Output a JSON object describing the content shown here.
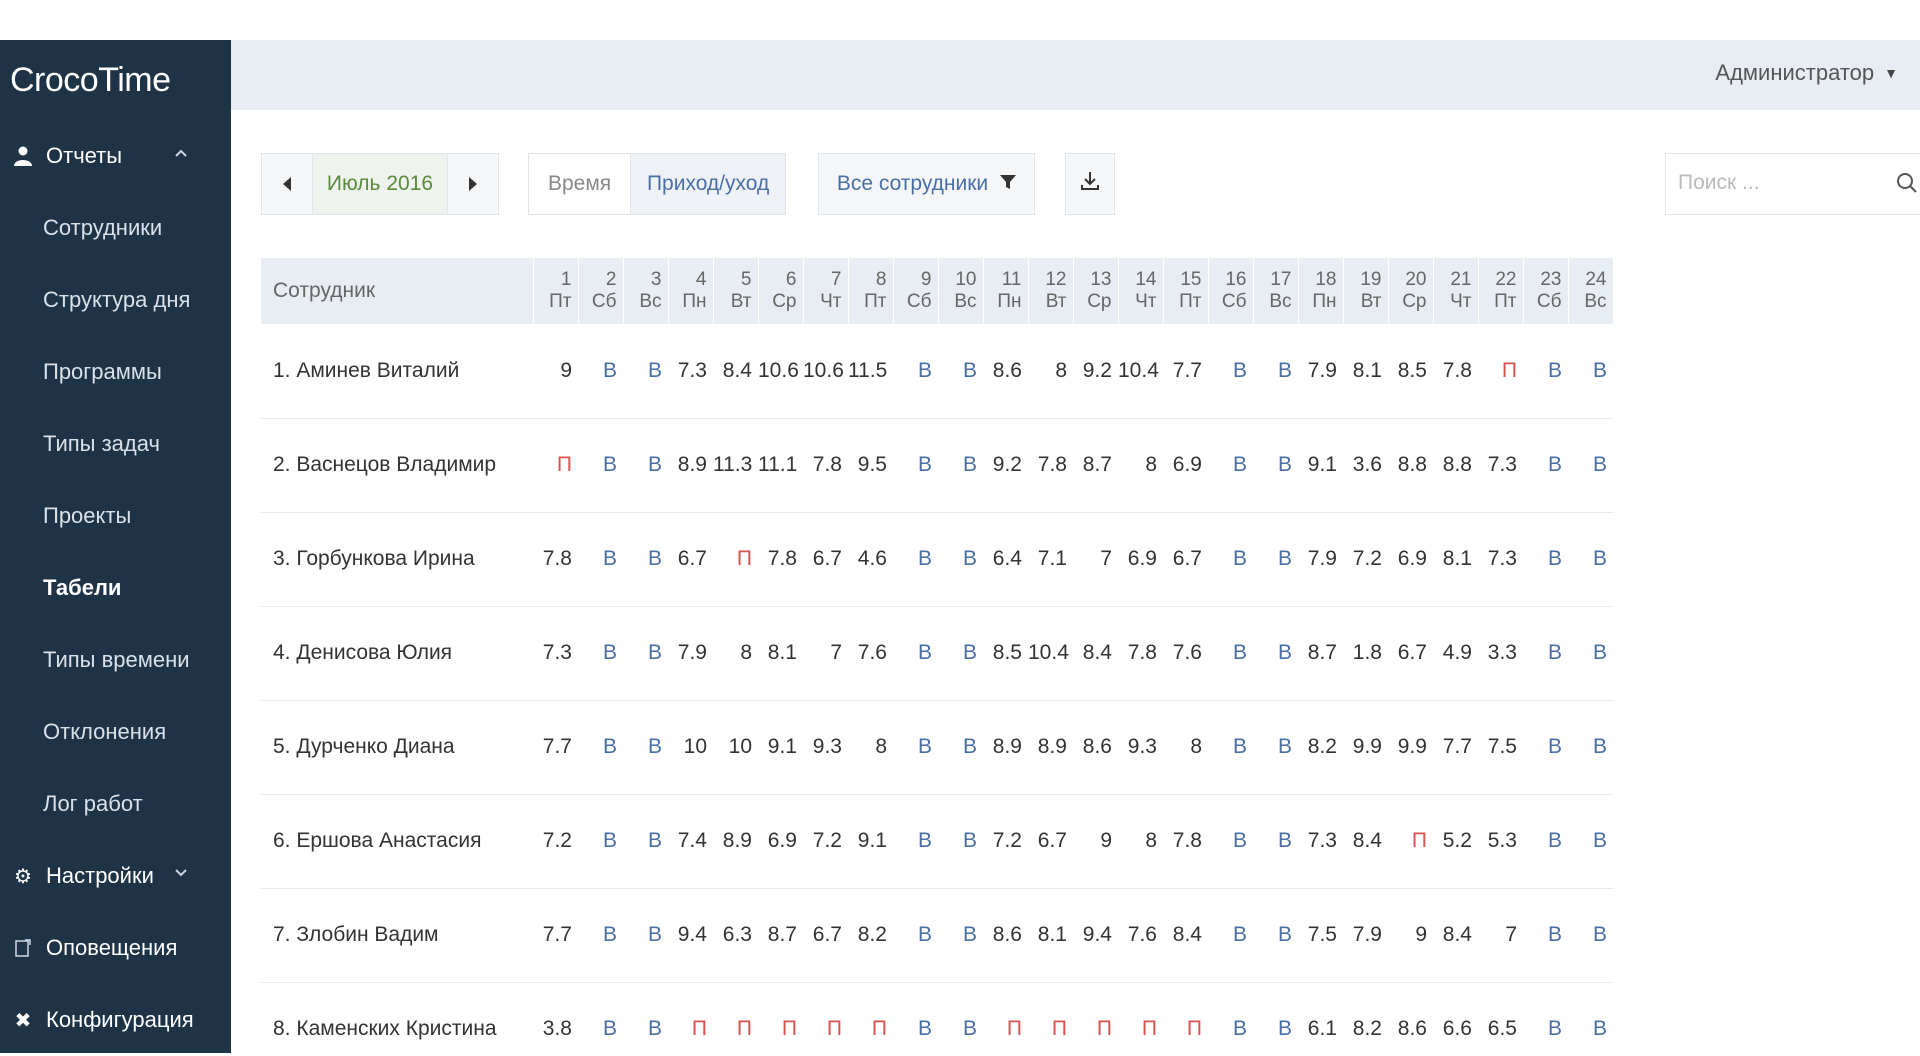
{
  "app": {
    "title": "CrocoTime"
  },
  "header": {
    "user_label": "Администратор"
  },
  "sidebar": {
    "reports_label": "Отчеты",
    "items": [
      {
        "label": "Сотрудники",
        "active": false
      },
      {
        "label": "Структура дня",
        "active": false
      },
      {
        "label": "Программы",
        "active": false
      },
      {
        "label": "Типы задач",
        "active": false
      },
      {
        "label": "Проекты",
        "active": false
      },
      {
        "label": "Табели",
        "active": true
      },
      {
        "label": "Типы времени",
        "active": false
      },
      {
        "label": "Отклонения",
        "active": false
      },
      {
        "label": "Лог работ",
        "active": false
      }
    ],
    "settings_label": "Настройки",
    "notifications_label": "Оповещения",
    "config_label": "Конфигурация"
  },
  "toolbar": {
    "month_label": "Июль 2016",
    "mode_time": "Время",
    "mode_in_out": "Приход/уход",
    "employees_filter": "Все сотрудники",
    "search_placeholder": "Поиск ..."
  },
  "table": {
    "name_header": "Сотрудник",
    "days": [
      {
        "num": "1",
        "dow": "Пт"
      },
      {
        "num": "2",
        "dow": "Сб"
      },
      {
        "num": "3",
        "dow": "Вс"
      },
      {
        "num": "4",
        "dow": "Пн"
      },
      {
        "num": "5",
        "dow": "Вт"
      },
      {
        "num": "6",
        "dow": "Ср"
      },
      {
        "num": "7",
        "dow": "Чт"
      },
      {
        "num": "8",
        "dow": "Пт"
      },
      {
        "num": "9",
        "dow": "Сб"
      },
      {
        "num": "10",
        "dow": "Вс"
      },
      {
        "num": "11",
        "dow": "Пн"
      },
      {
        "num": "12",
        "dow": "Вт"
      },
      {
        "num": "13",
        "dow": "Ср"
      },
      {
        "num": "14",
        "dow": "Чт"
      },
      {
        "num": "15",
        "dow": "Пт"
      },
      {
        "num": "16",
        "dow": "Сб"
      },
      {
        "num": "17",
        "dow": "Вс"
      },
      {
        "num": "18",
        "dow": "Пн"
      },
      {
        "num": "19",
        "dow": "Вт"
      },
      {
        "num": "20",
        "dow": "Ср"
      },
      {
        "num": "21",
        "dow": "Чт"
      },
      {
        "num": "22",
        "dow": "Пт"
      },
      {
        "num": "23",
        "dow": "Сб"
      },
      {
        "num": "24",
        "dow": "Вс"
      }
    ],
    "rows": [
      {
        "name": "1. Аминев Виталий",
        "values": [
          "9",
          "В",
          "В",
          "7.3",
          "8.4",
          "10.6",
          "10.6",
          "11.5",
          "В",
          "В",
          "8.6",
          "8",
          "9.2",
          "10.4",
          "7.7",
          "В",
          "В",
          "7.9",
          "8.1",
          "8.5",
          "7.8",
          "П",
          "В",
          "В"
        ]
      },
      {
        "name": "2. Васнецов Владимир",
        "values": [
          "П",
          "В",
          "В",
          "8.9",
          "11.3",
          "11.1",
          "7.8",
          "9.5",
          "В",
          "В",
          "9.2",
          "7.8",
          "8.7",
          "8",
          "6.9",
          "В",
          "В",
          "9.1",
          "3.6",
          "8.8",
          "8.8",
          "7.3",
          "В",
          "В"
        ]
      },
      {
        "name": "3. Горбункова Ирина",
        "values": [
          "7.8",
          "В",
          "В",
          "6.7",
          "П",
          "7.8",
          "6.7",
          "4.6",
          "В",
          "В",
          "6.4",
          "7.1",
          "7",
          "6.9",
          "6.7",
          "В",
          "В",
          "7.9",
          "7.2",
          "6.9",
          "8.1",
          "7.3",
          "В",
          "В"
        ]
      },
      {
        "name": "4. Денисова Юлия",
        "values": [
          "7.3",
          "В",
          "В",
          "7.9",
          "8",
          "8.1",
          "7",
          "7.6",
          "В",
          "В",
          "8.5",
          "10.4",
          "8.4",
          "7.8",
          "7.6",
          "В",
          "В",
          "8.7",
          "1.8",
          "6.7",
          "4.9",
          "3.3",
          "В",
          "В"
        ]
      },
      {
        "name": "5. Дурченко Диана",
        "values": [
          "7.7",
          "В",
          "В",
          "10",
          "10",
          "9.1",
          "9.3",
          "8",
          "В",
          "В",
          "8.9",
          "8.9",
          "8.6",
          "9.3",
          "8",
          "В",
          "В",
          "8.2",
          "9.9",
          "9.9",
          "7.7",
          "7.5",
          "В",
          "В"
        ]
      },
      {
        "name": "6. Ершова Анастасия",
        "values": [
          "7.2",
          "В",
          "В",
          "7.4",
          "8.9",
          "6.9",
          "7.2",
          "9.1",
          "В",
          "В",
          "7.2",
          "6.7",
          "9",
          "8",
          "7.8",
          "В",
          "В",
          "7.3",
          "8.4",
          "П",
          "5.2",
          "5.3",
          "В",
          "В"
        ]
      },
      {
        "name": "7. Злобин Вадим",
        "values": [
          "7.7",
          "В",
          "В",
          "9.4",
          "6.3",
          "8.7",
          "6.7",
          "8.2",
          "В",
          "В",
          "8.6",
          "8.1",
          "9.4",
          "7.6",
          "8.4",
          "В",
          "В",
          "7.5",
          "7.9",
          "9",
          "8.4",
          "7",
          "В",
          "В"
        ]
      },
      {
        "name": "8. Каменских Кристина",
        "values": [
          "3.8",
          "В",
          "В",
          "П",
          "П",
          "П",
          "П",
          "П",
          "В",
          "В",
          "П",
          "П",
          "П",
          "П",
          "П",
          "В",
          "В",
          "6.1",
          "8.2",
          "8.6",
          "6.6",
          "6.5",
          "В",
          "В"
        ]
      }
    ]
  },
  "colors": {
    "sidebar_bg": "#1f3347",
    "weekend": "#4a6fa5",
    "absent": "#d9534f",
    "month": "#5a8a3a"
  }
}
